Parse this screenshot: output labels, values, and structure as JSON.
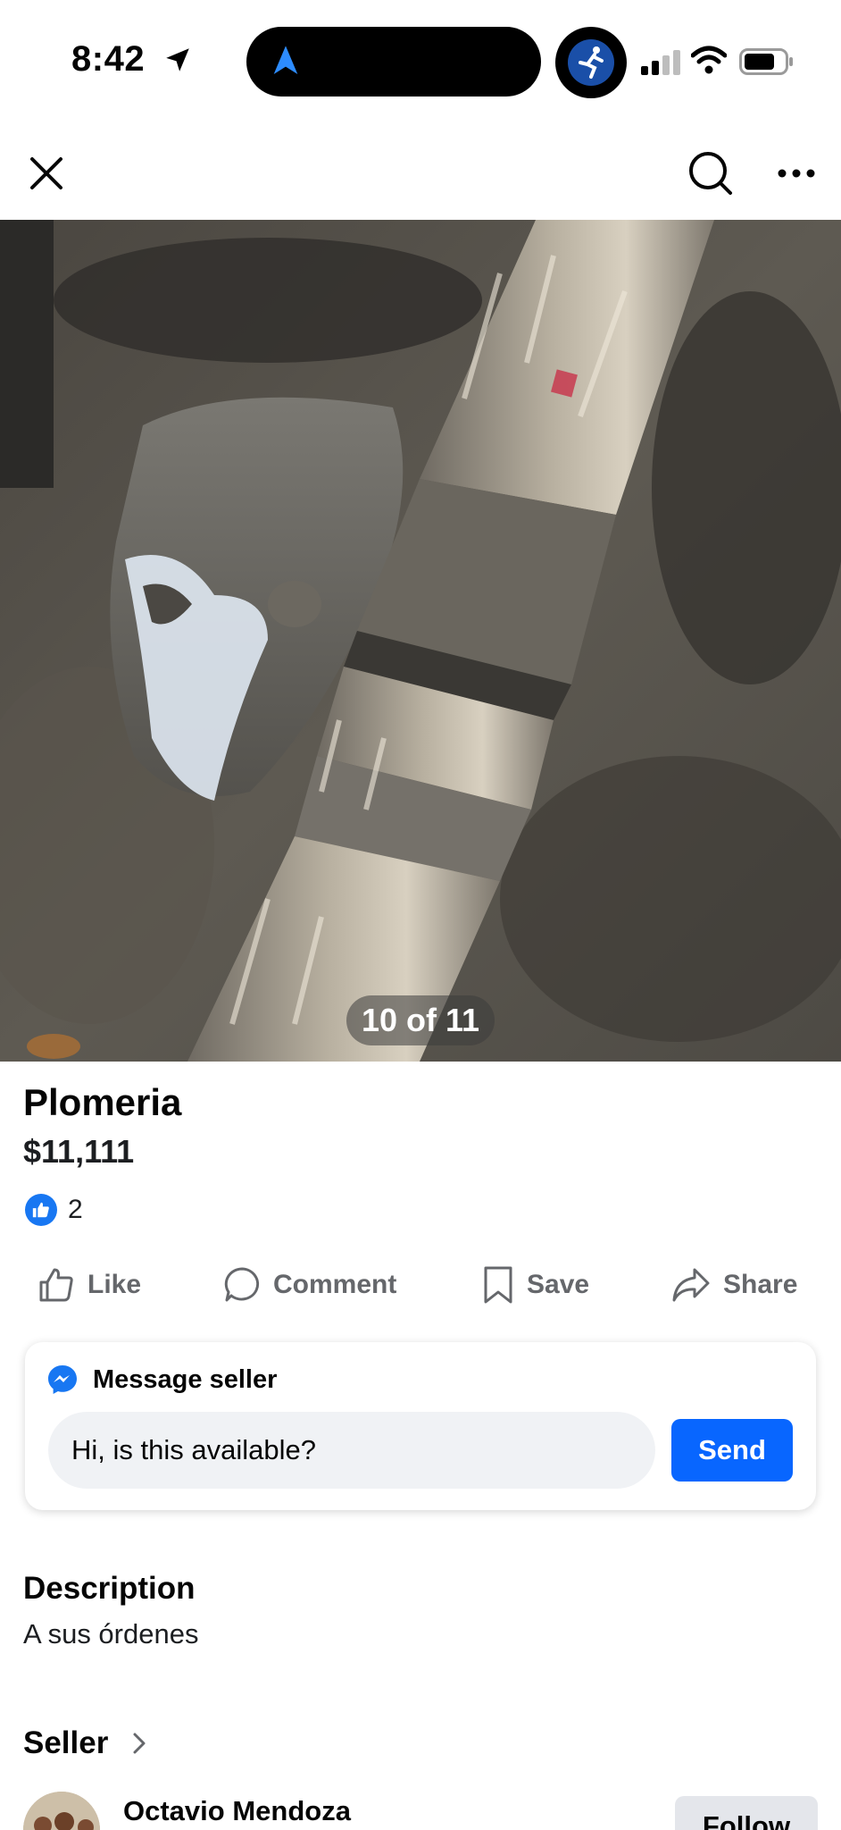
{
  "status_bar": {
    "time": "8:42"
  },
  "toolbar": {
    "close_icon": "close-icon",
    "search_icon": "search-icon",
    "more_icon": "more-options-icon"
  },
  "photo": {
    "counter": "10 of 11",
    "current_index": 10,
    "total": 11
  },
  "listing": {
    "title": "Plomeria",
    "price": "$11,111",
    "reaction_count": "2"
  },
  "actions": {
    "like": "Like",
    "comment": "Comment",
    "save": "Save",
    "share": "Share"
  },
  "message_card": {
    "heading": "Message seller",
    "input_value": "Hi, is this available?",
    "send_label": "Send"
  },
  "description": {
    "heading": "Description",
    "text": "A sus órdenes"
  },
  "seller": {
    "heading": "Seller",
    "name": "Octavio Mendoza",
    "follow_label": "Follow"
  },
  "colors": {
    "accent_blue": "#0866ff",
    "like_blue": "#1877f2",
    "secondary_text": "#65676b",
    "input_bg": "#f0f2f5",
    "button_gray": "#e4e6eb"
  }
}
